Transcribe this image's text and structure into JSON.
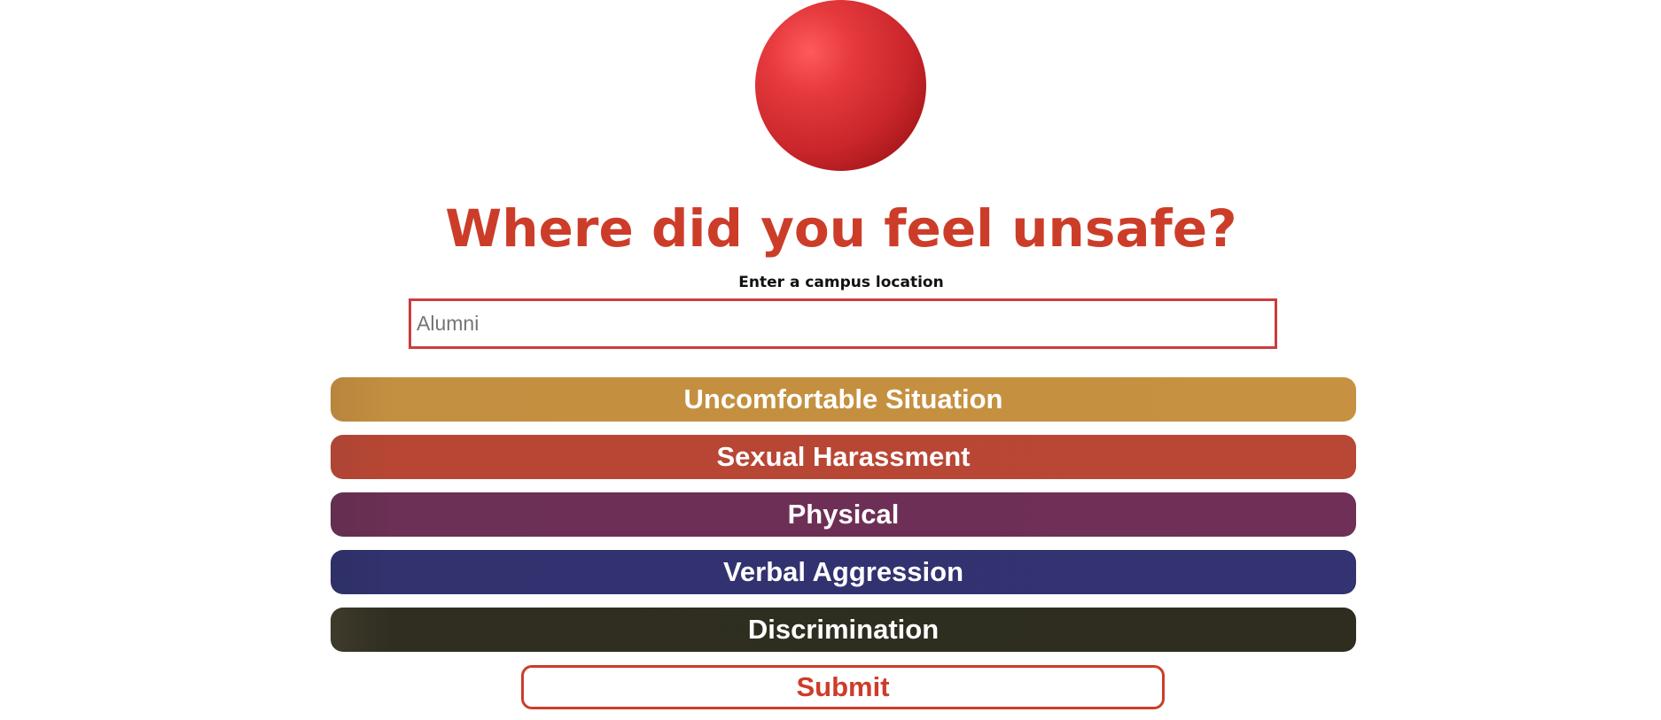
{
  "header": {
    "title": "Where did you feel unsafe?"
  },
  "location": {
    "label": "Enter a campus location",
    "value": "",
    "placeholder": "Alumni"
  },
  "categories": [
    {
      "label": "Uncomfortable Situation",
      "color": "#c69241"
    },
    {
      "label": "Sexual Harassment",
      "color": "#b94735"
    },
    {
      "label": "Physical",
      "color": "#702f57"
    },
    {
      "label": "Verbal Aggression",
      "color": "#333372"
    },
    {
      "label": "Discrimination",
      "color": "#2e2d1f"
    }
  ],
  "submit": {
    "label": "Submit"
  },
  "colors": {
    "accent": "#cc3d29",
    "logo": "#e63a3d"
  }
}
